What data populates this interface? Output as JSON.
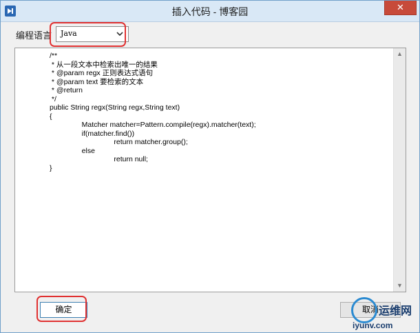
{
  "window": {
    "title": "插入代码 - 博客园",
    "close_label": "✕"
  },
  "language": {
    "label": "编程语言",
    "selected": "Java"
  },
  "code_lines": [
    "/**",
    " * 从一段文本中检索出唯一的结果",
    " * @param regx 正则表达式语句",
    " * @param text 要检索的文本",
    " * @return",
    " */",
    "public String regx(String regx,String text)",
    "{",
    "                Matcher matcher=Pattern.compile(regx).matcher(text);",
    "                if(matcher.find())",
    "                                return matcher.group();",
    "                else",
    "                                return null;",
    "}"
  ],
  "buttons": {
    "ok": "确定",
    "cancel": "取消"
  },
  "watermark": {
    "brand": "运维网",
    "url": "iyunv.com"
  },
  "colors": {
    "highlight": "#e03030",
    "titlebar": "#d9e8f6",
    "close": "#c74a3a"
  }
}
